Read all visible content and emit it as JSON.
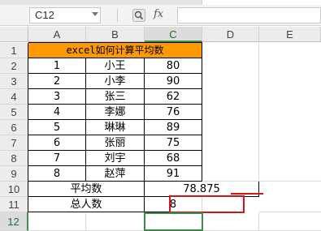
{
  "formula_bar": {
    "cell_ref": "C12",
    "fx_label": "fx",
    "formula": ""
  },
  "columns": [
    "A",
    "B",
    "C",
    "D",
    "E"
  ],
  "rows": [
    "1",
    "2",
    "3",
    "4",
    "5",
    "6",
    "7",
    "8",
    "9",
    "10",
    "11",
    "12"
  ],
  "selected_cell": "C12",
  "title": "excel如何计算平均数",
  "data_rows": [
    {
      "no": "1",
      "name": "小王",
      "score": "80"
    },
    {
      "no": "2",
      "name": "小李",
      "score": "90"
    },
    {
      "no": "3",
      "name": "张三",
      "score": "62"
    },
    {
      "no": "4",
      "name": "李娜",
      "score": "76"
    },
    {
      "no": "5",
      "name": "琳琳",
      "score": "89"
    },
    {
      "no": "6",
      "name": "张丽",
      "score": "75"
    },
    {
      "no": "7",
      "name": "刘宇",
      "score": "68"
    },
    {
      "no": "8",
      "name": "赵萍",
      "score": "91"
    }
  ],
  "summary": {
    "avg_label": "平均数",
    "avg_value": "78.875",
    "count_label": "总人数",
    "count_value": "8"
  },
  "colors": {
    "title_fill": "#ff9900",
    "highlight_red": "#d4161c",
    "selection_green": "#3c8c4a"
  }
}
